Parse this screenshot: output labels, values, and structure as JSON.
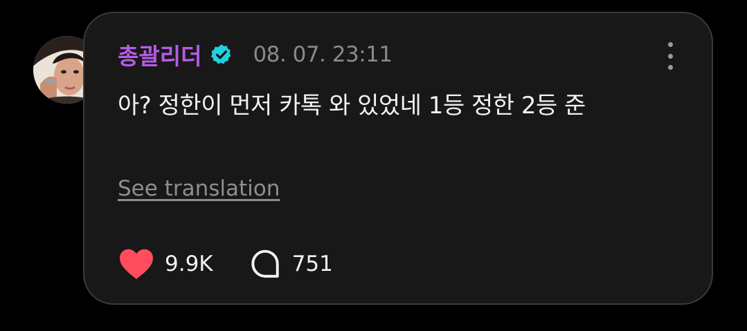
{
  "post": {
    "author_name": "총괄리더",
    "timestamp": "08. 07. 23:11",
    "text": "아? 정한이 먼저 카톡 와 있었네 1등 정한 2등 준",
    "translate_label": "See translation",
    "likes_count": "9.9K",
    "replies_count": "751",
    "liked": true
  },
  "icons": {
    "verified": "verified-badge-icon",
    "more": "more-vertical-icon",
    "like": "heart-icon",
    "reply": "speech-bubble-icon"
  },
  "colors": {
    "author_name": "#b45ce8",
    "verified_badge": "#1fd0e0",
    "heart": "#ff4d5e",
    "background": "#000000",
    "bubble": "#181818"
  }
}
